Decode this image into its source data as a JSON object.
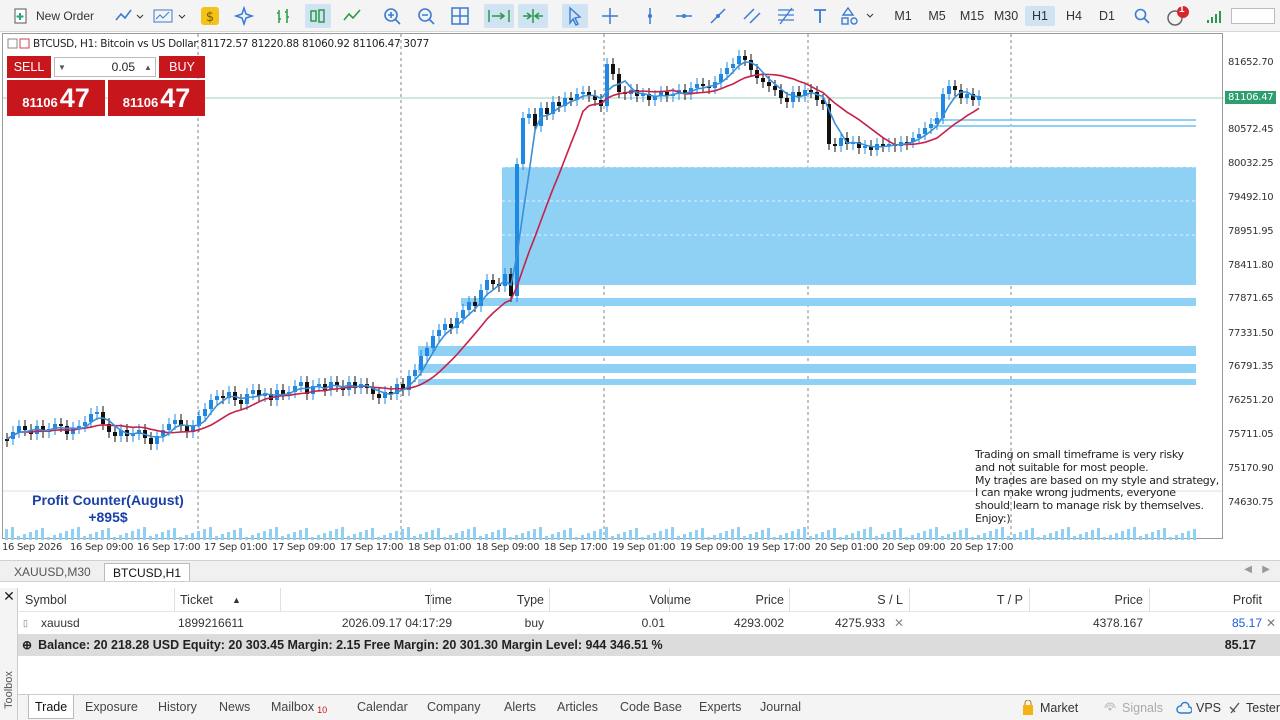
{
  "toolbar": {
    "new_order_label": "New Order",
    "timeframes": [
      "M1",
      "M5",
      "M15",
      "M30",
      "H1",
      "H4",
      "D1"
    ],
    "active_timeframe": "H1",
    "notification_count": "1"
  },
  "chart": {
    "title": "BTCUSD, H1:  Bitcoin vs US Dollar  81172.57 81220.88 81060.92 81106.47  3077",
    "sell_label": "SELL",
    "buy_label": "BUY",
    "lot_value": "0.05",
    "sell_price_main": "81106",
    "sell_price_big": "47",
    "buy_price_main": "81106",
    "buy_price_big": "47",
    "current_price": "81106.47",
    "profit_counter_title": "Profit Counter(August)",
    "profit_counter_value": "+895$",
    "note_lines": [
      "Trading on small timeframe is very risky",
      "and not suitable for most people.",
      "My trades are based on my style and strategy,",
      "I can make wrong judments, everyone",
      "should learn to manage risk by themselves.",
      "Enjoy:)"
    ],
    "price_labels": [
      "81652.70",
      "81106.47",
      "80572.45",
      "80032.25",
      "79492.10",
      "78951.95",
      "78411.80",
      "77871.65",
      "77331.50",
      "76791.35",
      "76251.20",
      "75711.05",
      "75170.90",
      "74630.75"
    ],
    "time_labels": [
      "16 Sep 2026",
      "16 Sep 09:00",
      "16 Sep 17:00",
      "17 Sep 01:00",
      "17 Sep 09:00",
      "17 Sep 17:00",
      "18 Sep 01:00",
      "18 Sep 09:00",
      "18 Sep 17:00",
      "19 Sep 01:00",
      "19 Sep 09:00",
      "19 Sep 17:00",
      "20 Sep 01:00",
      "20 Sep 09:00",
      "20 Sep 17:00"
    ],
    "colors": {
      "bull": "#1e88e5",
      "bear": "#111111",
      "zone": "#8fd0f5",
      "ma_fast": "#3a8fd8",
      "ma_slow": "#c8204a",
      "sell_bg": "#c8161d"
    }
  },
  "chart_tabs": [
    "XAUUSD,M30",
    "BTCUSD,H1"
  ],
  "active_chart_tab": "BTCUSD,H1",
  "trade": {
    "headers": {
      "symbol": "Symbol",
      "ticket": "Ticket",
      "time": "Time",
      "type": "Type",
      "volume": "Volume",
      "price": "Price",
      "sl": "S / L",
      "tp": "T / P",
      "price2": "Price",
      "profit": "Profit"
    },
    "row": {
      "symbol": "xauusd",
      "ticket": "1899216611",
      "time": "2026.09.17 04:17:29",
      "type": "buy",
      "volume": "0.01",
      "price": "4293.002",
      "sl": "4275.933",
      "tp": "",
      "price2": "4378.167",
      "profit": "85.17"
    },
    "balance_text": "Balance: 20 218.28 USD  Equity: 20 303.45  Margin: 2.15  Free Margin: 20 301.30  Margin Level: 944 346.51 %",
    "balance_profit": "85.17"
  },
  "toolbox_label": "Toolbox",
  "bottom_tabs": [
    "Trade",
    "Exposure",
    "History",
    "News",
    "Mailbox",
    "Calendar",
    "Company",
    "Alerts",
    "Articles",
    "Code Base",
    "Experts",
    "Journal"
  ],
  "mailbox_count": "10",
  "active_bottom_tab": "Trade",
  "right_tabs": {
    "market": "Market",
    "signals": "Signals",
    "vps": "VPS",
    "tester": "Tester"
  }
}
